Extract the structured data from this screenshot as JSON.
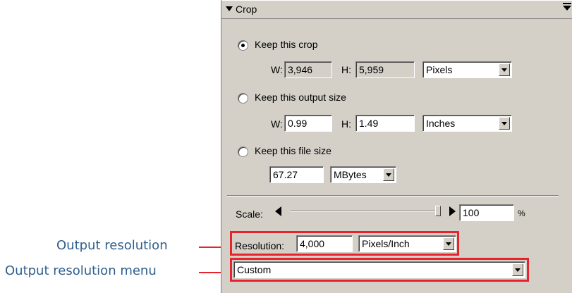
{
  "panel": {
    "title": "Crop",
    "keep_crop": {
      "label": "Keep this crop",
      "selected": true,
      "w_label": "W:",
      "w_value": "3,946",
      "h_label": "H:",
      "h_value": "5,959",
      "unit": "Pixels"
    },
    "keep_output": {
      "label": "Keep this output size",
      "selected": false,
      "w_label": "W:",
      "w_value": "0.99",
      "h_label": "H:",
      "h_value": "1.49",
      "unit": "Inches"
    },
    "keep_file": {
      "label": "Keep this file size",
      "selected": false,
      "value": "67.27",
      "unit": "MBytes"
    },
    "scale": {
      "label": "Scale:",
      "value": "100",
      "unit": "%"
    },
    "resolution": {
      "label": "Resolution:",
      "value": "4,000",
      "unit": "Pixels/Inch"
    },
    "resolution_menu": {
      "value": "Custom"
    }
  },
  "callouts": {
    "output_resolution": "Output resolution",
    "output_resolution_menu": "Output resolution menu"
  },
  "colors": {
    "highlight": "#e8232e",
    "callout_text": "#2d5f8c",
    "panel_bg": "#d4d0c8"
  }
}
